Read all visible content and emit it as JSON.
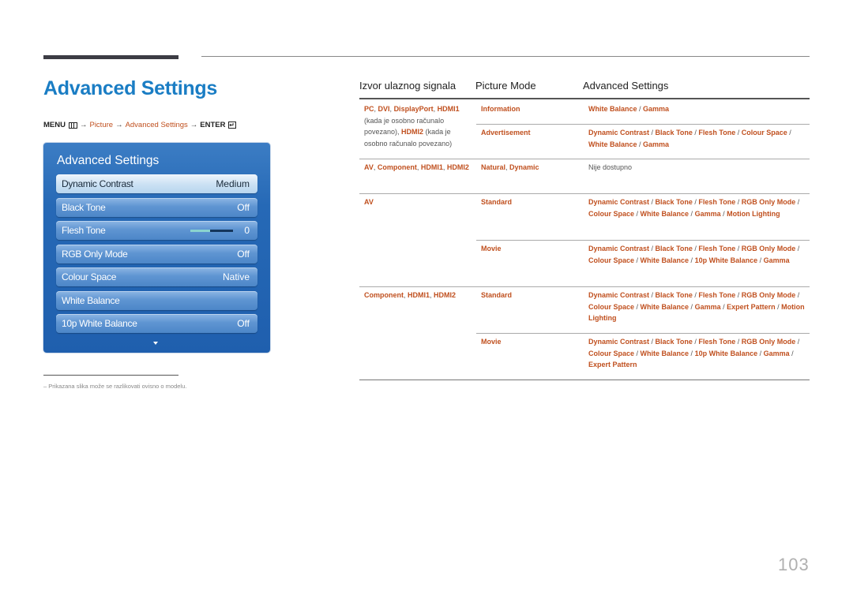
{
  "page": {
    "title": "Advanced Settings",
    "page_number": "103"
  },
  "menu_path": {
    "menu": "MENU",
    "arrow": "→",
    "picture": "Picture",
    "advanced": "Advanced Settings",
    "enter": "ENTER",
    "enter_glyph": "↵"
  },
  "osd": {
    "title": "Advanced Settings",
    "items": [
      {
        "label": "Dynamic Contrast",
        "value": "Medium",
        "selected": true
      },
      {
        "label": "Black Tone",
        "value": "Off"
      },
      {
        "label": "Flesh Tone",
        "value": "0",
        "slider_fraction": 0.45
      },
      {
        "label": "RGB Only Mode",
        "value": "Off"
      },
      {
        "label": "Colour Space",
        "value": "Native"
      },
      {
        "label": "White Balance",
        "value": ""
      },
      {
        "label": "10p White Balance",
        "value": "Off"
      }
    ]
  },
  "note": "– Prikazana slika može se razlikovati ovisno o modelu.",
  "table": {
    "headers": [
      "Izvor ulaznog signala",
      "Picture Mode",
      "Advanced Settings"
    ],
    "sep": " / ",
    "r1_src_a": "PC",
    "r1_src_b": "DVI",
    "r1_src_c": "DisplayPort",
    "r1_src_d": "HDMI1",
    "r1_src_note1": "(kada je osobno računalo povezano),",
    "r1_src_e": "HDMI2",
    "r1_src_note2": "(kada je osobno računalo povezano)",
    "r1_mode_a": "Information",
    "r1_set_a": [
      "White Balance",
      "Gamma"
    ],
    "r1_mode_b": "Advertisement",
    "r1_set_b": [
      "Dynamic Contrast",
      "Black Tone",
      "Flesh Tone",
      "Colour Space",
      "White Balance",
      "Gamma"
    ],
    "r2_src": [
      "AV",
      "Component",
      "HDMI1",
      "HDMI2"
    ],
    "r2_mode": [
      "Natural",
      "Dynamic"
    ],
    "r2_set": "Nije dostupno",
    "r3_src": "AV",
    "r3_mode_a": "Standard",
    "r3_set_a": [
      "Dynamic Contrast",
      "Black Tone",
      "Flesh Tone",
      "RGB Only Mode",
      "Colour Space",
      "White Balance",
      "Gamma",
      "Motion Lighting"
    ],
    "r3_mode_b": "Movie",
    "r3_set_b": [
      "Dynamic Contrast",
      "Black Tone",
      "Flesh Tone",
      "RGB Only Mode",
      "Colour Space",
      "White Balance",
      "10p White Balance",
      "Gamma"
    ],
    "r4_src": [
      "Component",
      "HDMI1",
      "HDMI2"
    ],
    "r4_mode_a": "Standard",
    "r4_set_a": [
      "Dynamic Contrast",
      "Black Tone",
      "Flesh Tone",
      "RGB Only Mode",
      "Colour Space",
      "White Balance",
      "Gamma",
      "Expert Pattern",
      "Motion Lighting"
    ],
    "r4_mode_b": "Movie",
    "r4_set_b": [
      "Dynamic Contrast",
      "Black Tone",
      "Flesh Tone",
      "RGB Only Mode",
      "Colour Space",
      "White Balance",
      "10p White Balance",
      "Gamma",
      "Expert Pattern"
    ]
  },
  "colors": {
    "title_blue": "#1a7dc4",
    "link_orange": "#c0501f",
    "osd_blue": "#2669b6"
  }
}
